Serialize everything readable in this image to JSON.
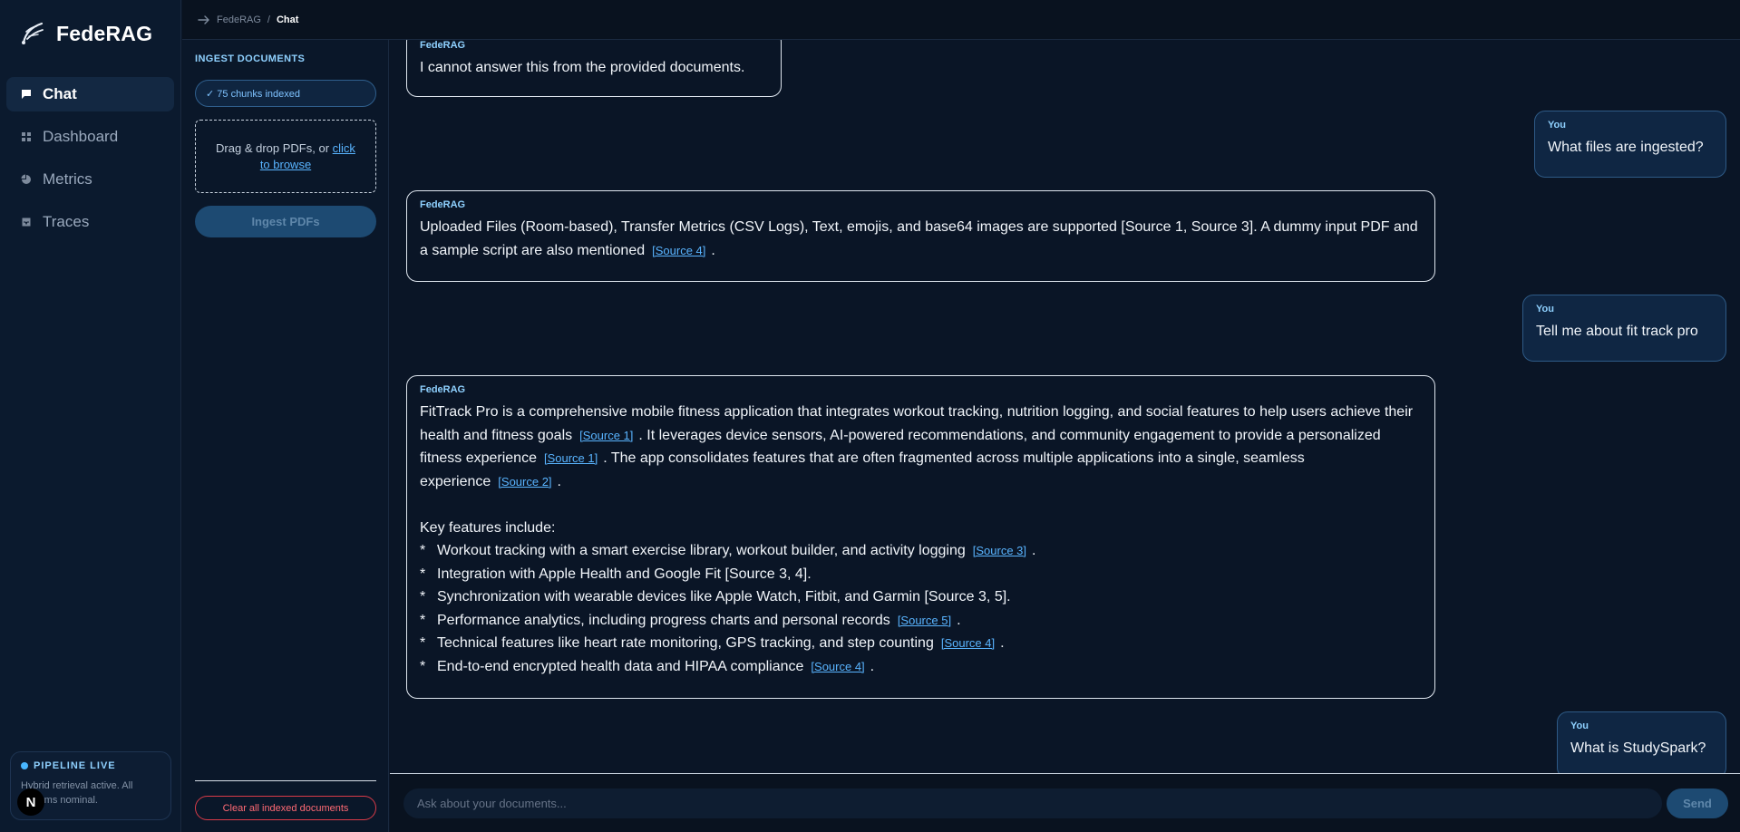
{
  "app": {
    "name": "FedeRAG"
  },
  "breadcrumb": {
    "root": "FedeRAG",
    "separator": "/",
    "current": "Chat"
  },
  "nav": {
    "items": [
      {
        "label": "Chat",
        "icon": "chat-bubble-icon",
        "active": true
      },
      {
        "label": "Dashboard",
        "icon": "grid-icon",
        "active": false
      },
      {
        "label": "Metrics",
        "icon": "pie-chart-icon",
        "active": false
      },
      {
        "label": "Traces",
        "icon": "tray-icon",
        "active": false
      }
    ]
  },
  "pipeline": {
    "title": "PIPELINE LIVE",
    "text": "Hybrid retrieval active. All systems nominal."
  },
  "avatar_badge": "N",
  "ingest": {
    "title": "INGEST DOCUMENTS",
    "chunks_badge": "✓ 75 chunks indexed",
    "dropzone_text": "Drag & drop PDFs, or ",
    "dropzone_link": "click to browse",
    "ingest_button": "Ingest PDFs",
    "clear_button": "Clear all indexed documents"
  },
  "chat": {
    "messages": [
      {
        "speaker": "FedeRAG",
        "role": "assistant",
        "text": "I cannot answer this from the provided documents."
      },
      {
        "speaker": "You",
        "role": "user",
        "text": "What files are ingested?"
      },
      {
        "speaker": "FedeRAG",
        "role": "assistant",
        "text_1": "Uploaded Files (Room-based), Transfer Metrics (CSV Logs), Text, emojis, and base64 images are supported [Source 1, Source 3]. A dummy input PDF and a sample script are also mentioned",
        "src_1": "[Source 4]",
        "text_2": "."
      },
      {
        "speaker": "You",
        "role": "user",
        "text": "Tell me about fit track pro"
      },
      {
        "speaker": "FedeRAG",
        "role": "assistant",
        "p1_a": "FitTrack Pro is a comprehensive mobile fitness application that integrates workout tracking, nutrition logging, and social features to help users achieve their health and fitness goals",
        "p1_src1": "[Source 1]",
        "p1_b": ". It leverages device sensors, AI-powered recommendations, and community engagement to provide a personalized fitness experience",
        "p1_src2": "[Source 1]",
        "p1_c": ". The app consolidates features that are often fragmented across multiple applications into a single, seamless experience",
        "p1_src3": "[Source 2]",
        "p1_d": ".",
        "key_heading": "Key features include:",
        "bullet_marker": "*",
        "bullets": [
          {
            "text": "Workout tracking with a smart exercise library, workout builder, and activity logging",
            "src": "[Source 3]",
            "tail": "."
          },
          {
            "text": "Integration with Apple Health and Google Fit [Source 3, 4].",
            "src": "",
            "tail": ""
          },
          {
            "text": "Synchronization with wearable devices like Apple Watch, Fitbit, and Garmin [Source 3, 5].",
            "src": "",
            "tail": ""
          },
          {
            "text": "Performance analytics, including progress charts and personal records",
            "src": "[Source 5]",
            "tail": "."
          },
          {
            "text": "Technical features like heart rate monitoring, GPS tracking, and step counting",
            "src": "[Source 4]",
            "tail": "."
          },
          {
            "text": "End-to-end encrypted health data and HIPAA compliance",
            "src": "[Source 4]",
            "tail": "."
          }
        ]
      },
      {
        "speaker": "You",
        "role": "user",
        "text": "What is StudySpark?"
      }
    ]
  },
  "composer": {
    "placeholder": "Ask about your documents...",
    "send_label": "Send"
  },
  "colors": {
    "accent": "#59b4ff",
    "background": "#0a1526",
    "danger": "#d93b48"
  }
}
